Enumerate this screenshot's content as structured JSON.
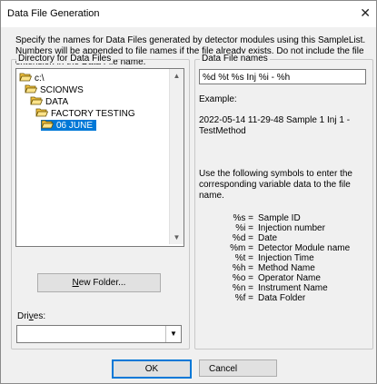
{
  "window": {
    "title": "Data File Generation",
    "close_icon": "close-icon"
  },
  "description": "Specify the names for Data Files generated by detector modules using this SampleList. Numbers will be appended to file names if the file already exists. Do not include the file extension in the Data File name.",
  "directory": {
    "group_label": "Directory for Data Files",
    "items": [
      {
        "label": "c:\\",
        "icon": "open-folder-icon",
        "selected": false
      },
      {
        "label": "SCIONWS",
        "icon": "open-folder-icon",
        "selected": false
      },
      {
        "label": "DATA",
        "icon": "open-folder-icon",
        "selected": false
      },
      {
        "label": "FACTORY TESTING",
        "icon": "open-folder-icon",
        "selected": false
      },
      {
        "label": "06 JUNE",
        "icon": "open-folder-icon",
        "selected": true
      }
    ],
    "new_folder_prefix": "",
    "new_folder_mnemonic": "N",
    "new_folder_rest": "ew Folder...",
    "drives_prefix": "Dri",
    "drives_mnemonic": "v",
    "drives_rest": "es:",
    "drives_value": ""
  },
  "datafile": {
    "group_label": "Data File names",
    "pattern": "%d %t %s Inj %i - %h",
    "example_label": "Example:",
    "example_value": "2022-05-14 11-29-48 Sample 1 Inj 1 - TestMethod",
    "instructions": "Use the following symbols to enter the corresponding variable data to the file name.",
    "symbols": [
      {
        "key": "%s =",
        "value": "Sample ID"
      },
      {
        "key": "%i =",
        "value": "Injection number"
      },
      {
        "key": "%d =",
        "value": "Date"
      },
      {
        "key": "%m =",
        "value": "Detector Module name"
      },
      {
        "key": "%t =",
        "value": "Injection Time"
      },
      {
        "key": "%h =",
        "value": "Method Name"
      },
      {
        "key": "%o =",
        "value": "Operator Name"
      },
      {
        "key": "%n =",
        "value": "Instrument Name"
      },
      {
        "key": "%f =",
        "value": "Data Folder"
      }
    ]
  },
  "buttons": {
    "ok": "OK",
    "cancel": "Cancel"
  },
  "colors": {
    "selection": "#0078d7",
    "folder": "#f5c542"
  }
}
